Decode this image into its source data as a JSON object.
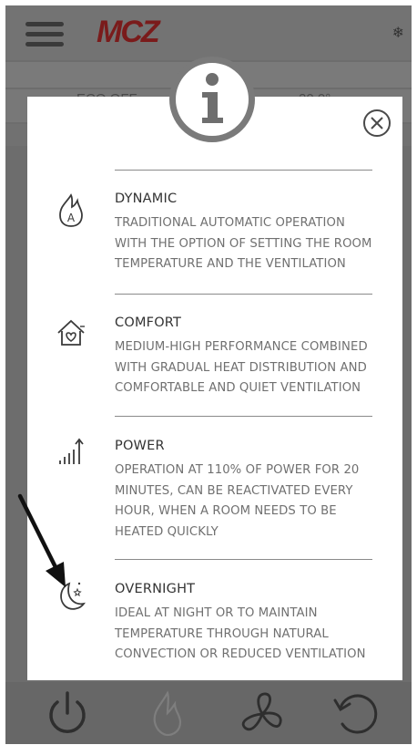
{
  "app": {
    "logo": "MCZ",
    "band_left": "ECO OFF",
    "band_right": "20.0°"
  },
  "modal": {
    "modes": [
      {
        "title": "DYNAMIC",
        "description": "TRADITIONAL AUTOMATIC OPERATION WITH THE OPTION OF SETTING THE ROOM TEMPERATURE AND THE VENTILATION",
        "icon": "flame-a-icon",
        "icon_letter": "A"
      },
      {
        "title": "COMFORT",
        "description": "MEDIUM-HIGH PERFORMANCE COMBINED WITH GRADUAL HEAT DISTRIBUTION AND COMFORTABLE AND QUIET VENTILATION",
        "icon": "house-heart-icon"
      },
      {
        "title": "POWER",
        "description": "OPERATION AT 110% OF POWER FOR 20 MINUTES, CAN BE REACTIVATED EVERY HOUR, WHEN A ROOM NEEDS TO BE HEATED QUICKLY",
        "icon": "power-bars-icon"
      },
      {
        "title": "OVERNIGHT",
        "description": "IDEAL AT NIGHT OR TO MAINTAIN TEMPERATURE THROUGH NATURAL CONVECTION OR REDUCED VENTILATION",
        "icon": "moon-stars-icon"
      }
    ]
  }
}
